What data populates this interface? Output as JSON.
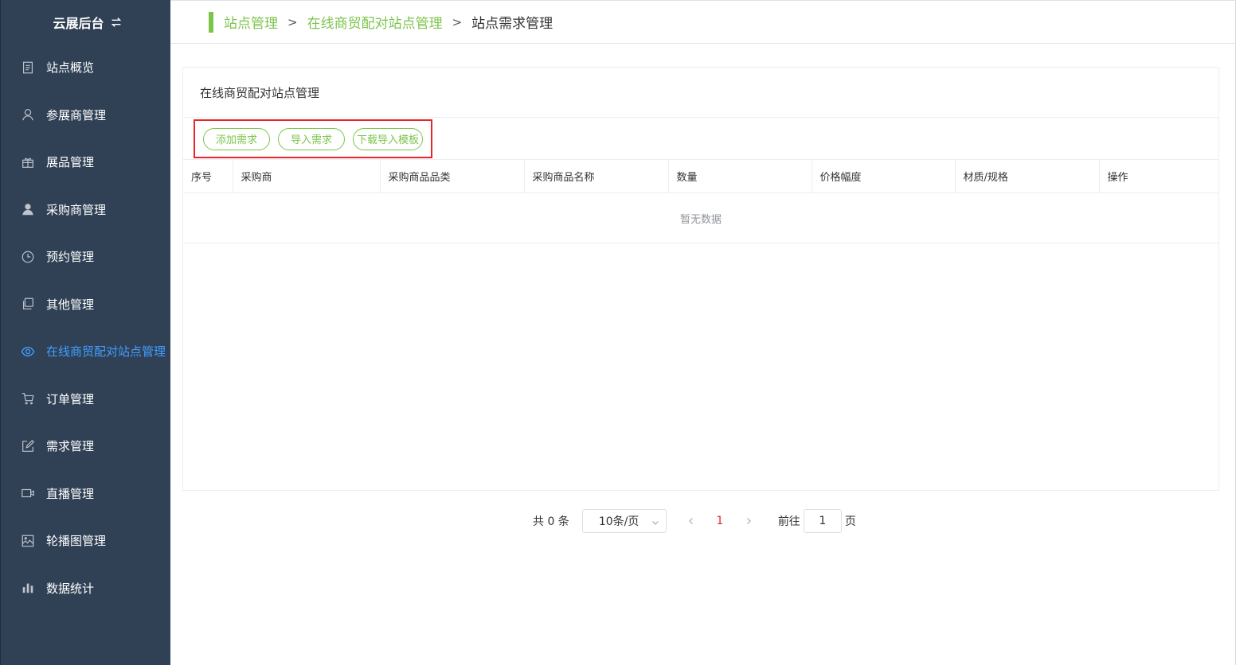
{
  "brand": {
    "title": "云展后台",
    "toggle_icon": "swap-icon"
  },
  "sidebar": {
    "items": [
      {
        "label": "站点概览",
        "icon": "document-icon"
      },
      {
        "label": "参展商管理",
        "icon": "user-icon"
      },
      {
        "label": "展品管理",
        "icon": "gift-icon"
      },
      {
        "label": "采购商管理",
        "icon": "person-filled-icon"
      },
      {
        "label": "预约管理",
        "icon": "clock-icon"
      },
      {
        "label": "其他管理",
        "icon": "copy-icon"
      },
      {
        "label": "在线商贸配对站点管理",
        "icon": "eye-icon",
        "active": true
      },
      {
        "label": "订单管理",
        "icon": "cart-icon"
      },
      {
        "label": "需求管理",
        "icon": "edit-icon"
      },
      {
        "label": "直播管理",
        "icon": "video-icon"
      },
      {
        "label": "轮播图管理",
        "icon": "picture-icon"
      },
      {
        "label": "数据统计",
        "icon": "bar-chart-icon"
      }
    ],
    "active_color": "#409eff",
    "background": "#304156"
  },
  "breadcrumb": {
    "items": [
      "站点管理",
      "在线商贸配对站点管理",
      "站点需求管理"
    ],
    "separator": ">",
    "accent": "#7cc44b"
  },
  "panel": {
    "title": "在线商贸配对站点管理",
    "buttons": {
      "add": "添加需求",
      "import": "导入需求",
      "download_template": "下载导入模板"
    }
  },
  "table": {
    "columns": [
      "序号",
      "采购商",
      "采购商品品类",
      "采购商品名称",
      "数量",
      "价格幅度",
      "材质/规格",
      "操作"
    ],
    "empty_text": "暂无数据"
  },
  "pagination": {
    "total_text": "共 0 条",
    "page_size": "10条/页",
    "current_page": "1",
    "goto_prefix": "前往",
    "goto_value": "1",
    "goto_suffix": "页"
  }
}
